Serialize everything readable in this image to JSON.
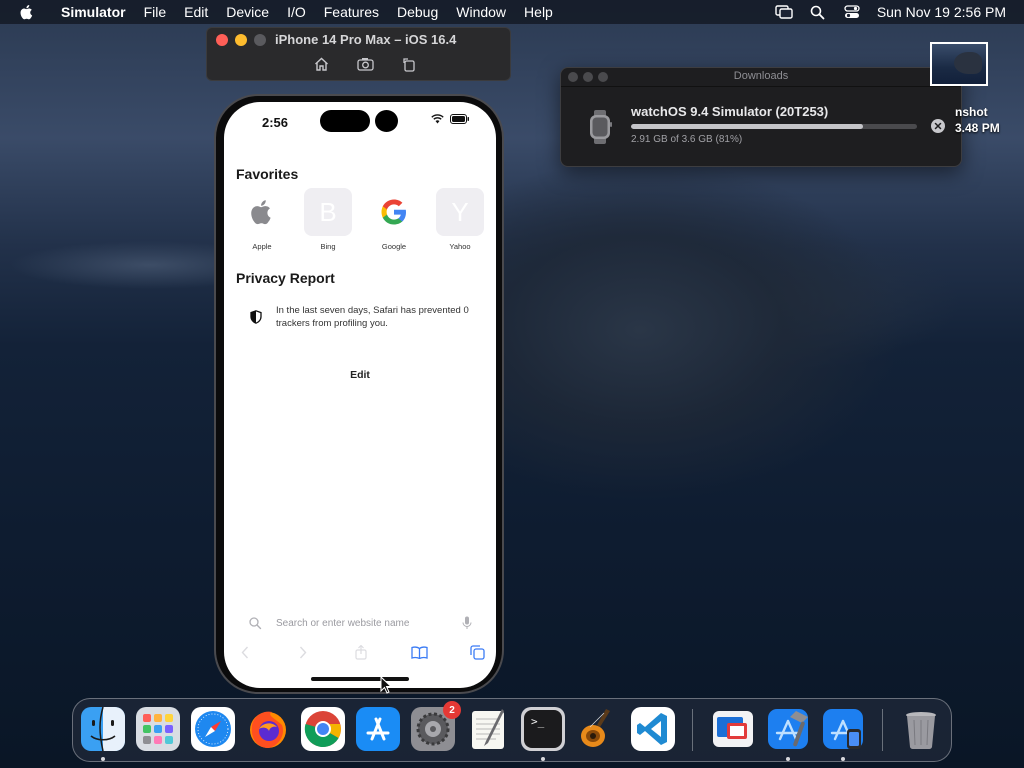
{
  "menubar": {
    "app_name": "Simulator",
    "menus": [
      "File",
      "Edit",
      "Device",
      "I/O",
      "Features",
      "Debug",
      "Window",
      "Help"
    ],
    "clock": "Sun Nov 19  2:56 PM"
  },
  "simulator": {
    "window_title": "iPhone 14 Pro Max – iOS 16.4",
    "traffic_colors": [
      "#ff5f57",
      "#febc2e",
      "#5a5a5e"
    ]
  },
  "iphone": {
    "time": "2:56",
    "favorites_title": "Favorites",
    "favorites": [
      {
        "label": "Apple",
        "letter": ""
      },
      {
        "label": "Bing",
        "letter": "B"
      },
      {
        "label": "Google",
        "letter": ""
      },
      {
        "label": "Yahoo",
        "letter": "Y"
      }
    ],
    "privacy_title": "Privacy Report",
    "privacy_text": "In the last seven days, Safari has prevented 0 trackers from profiling you.",
    "edit_label": "Edit",
    "search_placeholder": "Search or enter website name"
  },
  "downloads": {
    "window_title": "Downloads",
    "item_name": "watchOS 9.4 Simulator (20T253)",
    "progress_fraction": 0.81,
    "status": "2.91 GB of 3.6 GB (81%)"
  },
  "desktop": {
    "file_label_line1": "nshot",
    "file_label_line2": "3.48 PM"
  },
  "dock": {
    "badge_system_settings": "2",
    "terminal_prompt": ">_",
    "items": [
      "finder-icon",
      "launchpad-icon",
      "safari-icon",
      "firefox-icon",
      "chrome-icon",
      "app-store-icon",
      "system-settings-icon",
      "textedit-icon",
      "terminal-icon",
      "garageband-icon",
      "vscode-icon",
      "screens-icon",
      "xcode-icon",
      "simulator-icon",
      "trash-icon"
    ]
  }
}
